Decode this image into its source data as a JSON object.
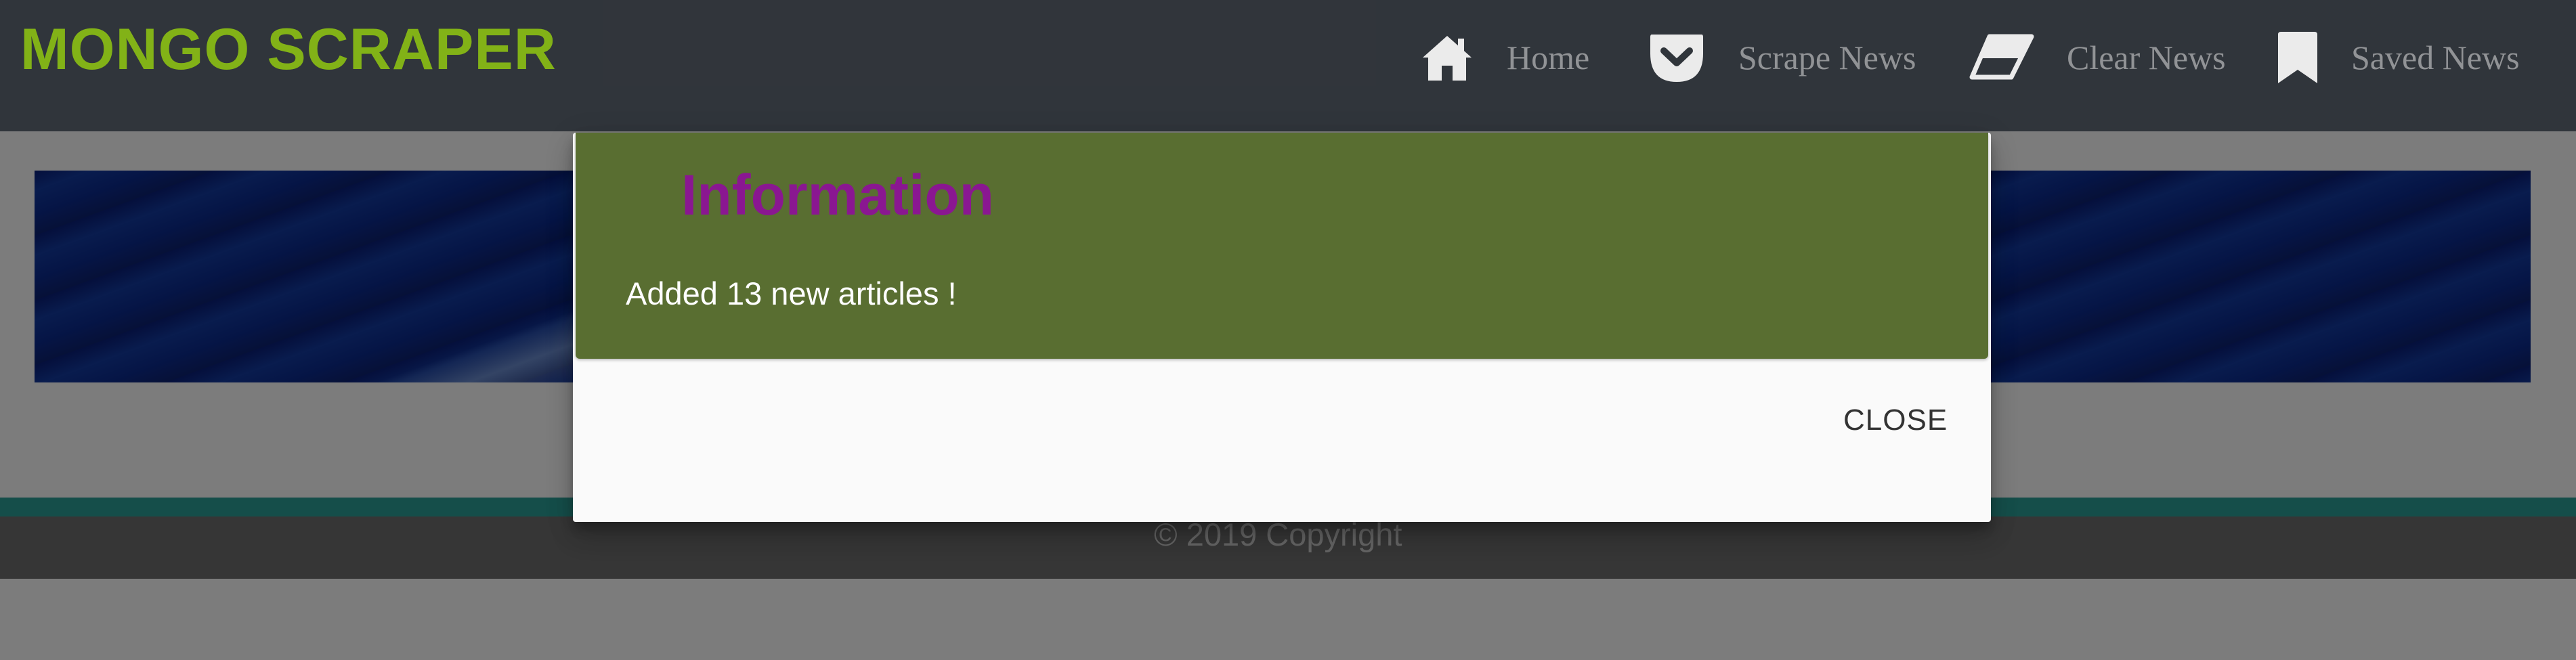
{
  "navbar": {
    "brand": "MONGO SCRAPER",
    "links": [
      {
        "label": "Home",
        "icon": "home-icon"
      },
      {
        "label": "Scrape News",
        "icon": "pocket-icon"
      },
      {
        "label": "Clear News",
        "icon": "eraser-icon"
      },
      {
        "label": "Saved News",
        "icon": "bookmark-icon"
      }
    ]
  },
  "footer": {
    "copyright": "© 2019 Copyright"
  },
  "modal": {
    "title": "Information",
    "message": "Added 13 new articles !",
    "close_label": "CLOSE"
  },
  "colors": {
    "navbar_bg": "#353a40",
    "brand": "#8ec21a",
    "modal_content_bg": "#596e31",
    "modal_title": "#8a1791",
    "teal_band": "#2a9d95"
  }
}
